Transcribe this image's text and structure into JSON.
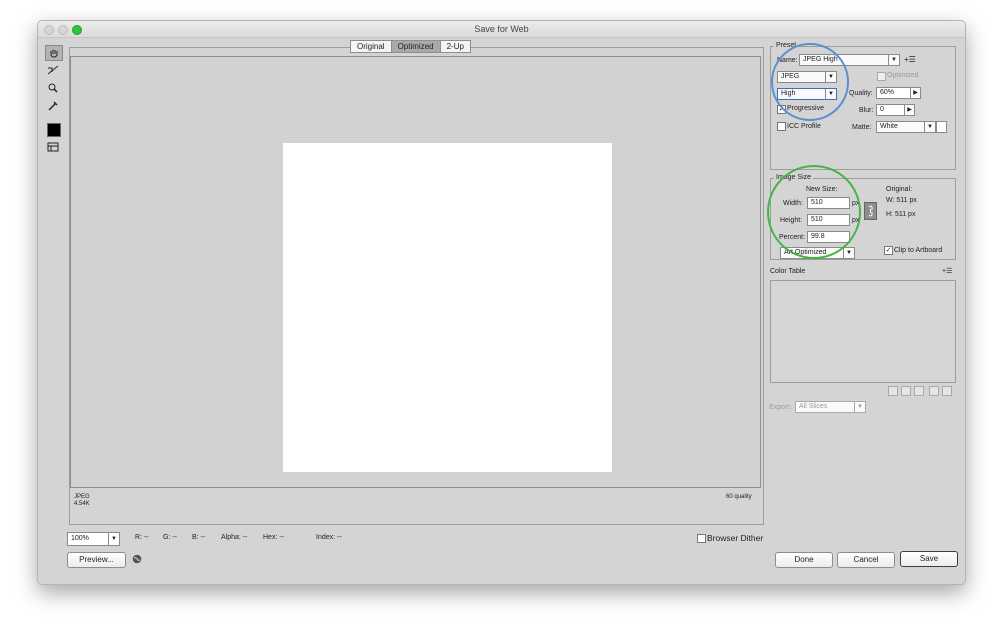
{
  "window": {
    "title": "Save for Web"
  },
  "tabs": [
    "Original",
    "Optimized",
    "2-Up"
  ],
  "tools": [
    "hand-tool-icon",
    "slice-select-tool-icon",
    "zoom-tool-icon",
    "eyedropper-tool-icon",
    "eyedropper-color-swatch",
    "toggle-slices-icon"
  ],
  "canvas": {
    "format": "JPEG",
    "size": "4.54K",
    "quality_label": "60 quality"
  },
  "preset": {
    "legend": "Preset",
    "name_label": "Name:",
    "name_value": "JPEG High",
    "format_value": "JPEG",
    "optimized_label": "Optimized",
    "optimized_checked": false,
    "compression_value": "High",
    "quality_label": "Quality:",
    "quality_value": "60%",
    "progressive_label": "Progressive",
    "progressive_checked": true,
    "blur_label": "Blur:",
    "blur_value": "0",
    "icc_label": "ICC Profile",
    "icc_checked": false,
    "matte_label": "Matte:",
    "matte_value": "White"
  },
  "image_size": {
    "legend": "Image Size",
    "new_size_label": "New Size:",
    "width_label": "Width:",
    "width_value": "510",
    "height_label": "Height:",
    "height_value": "510",
    "unit": "px",
    "percent_label": "Percent:",
    "percent_value": "99.8",
    "resample_value": "Art Optimized",
    "original_label": "Original:",
    "orig_w": "W:  511 px",
    "orig_h": "H:  511 px",
    "clip_label": "Clip to Artboard",
    "clip_checked": true
  },
  "color_table": {
    "label": "Color Table"
  },
  "export": {
    "label": "Export:",
    "value": "All Slices"
  },
  "status": {
    "zoom": "100%",
    "r": "R: --",
    "g": "G: --",
    "b": "B: --",
    "alpha": "Alpha: --",
    "hex": "Hex: --",
    "index": "Index: --",
    "browser_dither": "Browser Dither"
  },
  "buttons": {
    "preview": "Preview...",
    "done": "Done",
    "cancel": "Cancel",
    "save": "Save"
  },
  "colors": {
    "annotation_blue": "#5b8fd0",
    "annotation_green": "#43b545"
  }
}
